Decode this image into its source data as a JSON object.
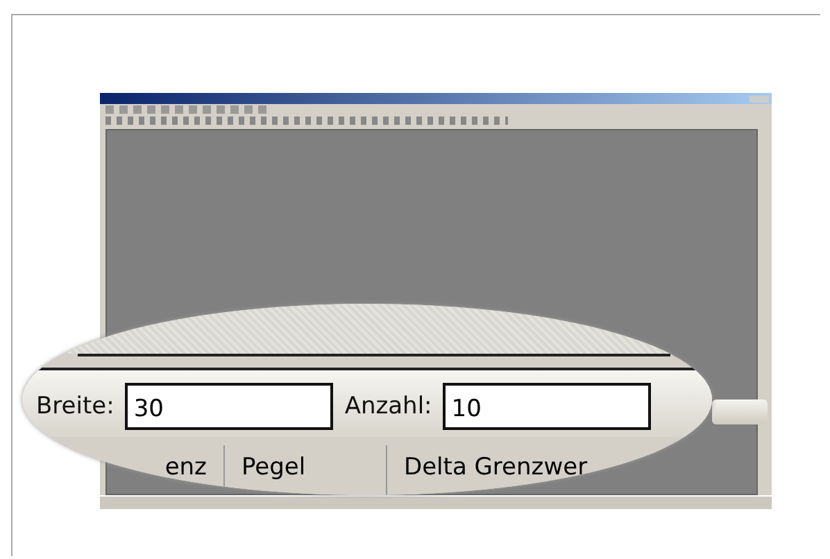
{
  "magnifier": {
    "fields": [
      {
        "label": "Breite:",
        "value": "30"
      },
      {
        "label": "Anzahl:",
        "value": "10"
      }
    ],
    "columns": [
      "enz",
      "Pegel",
      "Delta Grenzwer"
    ]
  }
}
